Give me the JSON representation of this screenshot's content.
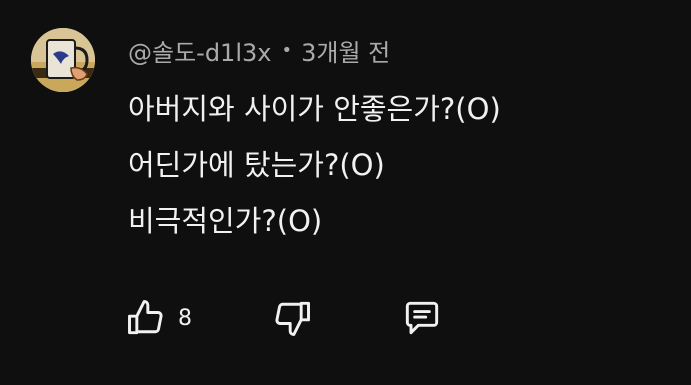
{
  "comment": {
    "author": "@솔도-d1l3x",
    "separator": "•",
    "time": "3개월 전",
    "lines": [
      "아버지와 사이가 안좋은가?(O)",
      "어딘가에 탔는가?(O)",
      "비극적인가?(O)"
    ],
    "like_count": "8",
    "icons": {
      "avatar": "mug-avatar",
      "like": "thumbs-up-icon",
      "dislike": "thumbs-down-icon",
      "reply": "comment-icon"
    }
  },
  "colors": {
    "background": "#0f0f0f",
    "primary_text": "#f1f1f1",
    "secondary_text": "#aaaaaa"
  }
}
